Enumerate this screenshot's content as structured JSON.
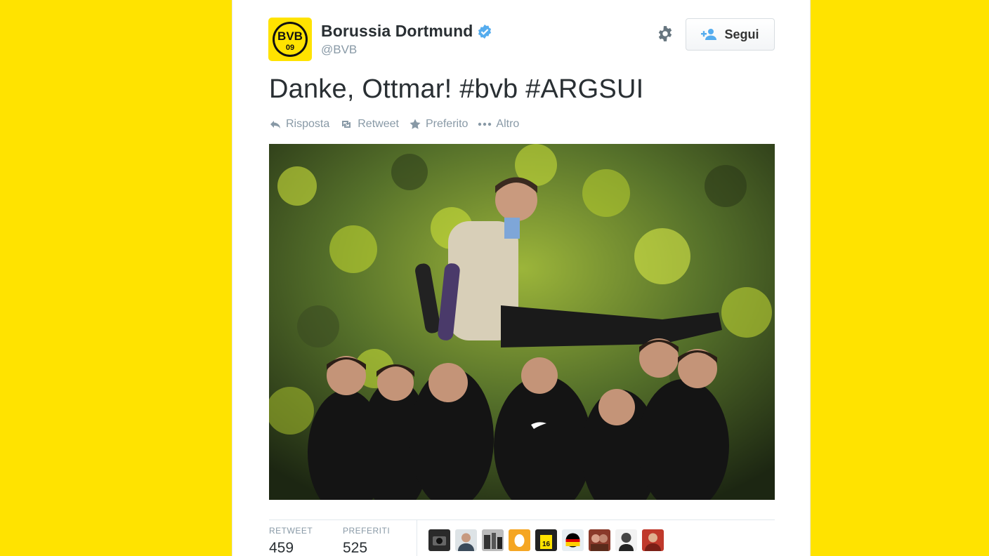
{
  "page": {
    "background": "#ffe300"
  },
  "account": {
    "name": "Borussia Dortmund",
    "handle": "@BVB",
    "avatar_icon": "bvb-09-logo-icon",
    "verified_icon": "verified-badge-icon",
    "logo_top_text": "BVB",
    "logo_bottom_text": "09"
  },
  "header": {
    "settings_icon": "gear-icon",
    "follow_label": "Segui",
    "follow_icon": "add-user-icon"
  },
  "tweet": {
    "text": "Danke, Ottmar! #bvb #ARGSUI",
    "photo_icon": "celebration-photo"
  },
  "actions": [
    {
      "label": "Risposta",
      "icon": "reply-icon"
    },
    {
      "label": "Retweet",
      "icon": "retweet-icon"
    },
    {
      "label": "Preferito",
      "icon": "star-icon"
    },
    {
      "label": "Altro",
      "icon": "more-dots-icon"
    }
  ],
  "stats": {
    "retweets_label": "RETWEET",
    "retweets_value": "459",
    "favorites_label": "PREFERITI",
    "favorites_value": "525"
  },
  "favoriters": [
    {
      "icon": "user-avatar-camera"
    },
    {
      "icon": "user-avatar-face"
    },
    {
      "icon": "user-avatar-bw"
    },
    {
      "icon": "user-avatar-egg"
    },
    {
      "icon": "user-avatar-jersey-16"
    },
    {
      "icon": "user-avatar-flag"
    },
    {
      "icon": "user-avatar-couple"
    },
    {
      "icon": "user-avatar-portrait"
    },
    {
      "icon": "user-avatar-red"
    }
  ],
  "colors": {
    "accent_yellow": "#ffe300",
    "text_dark": "#292f33",
    "text_muted": "#8899a6",
    "verified_blue": "#55acee"
  }
}
